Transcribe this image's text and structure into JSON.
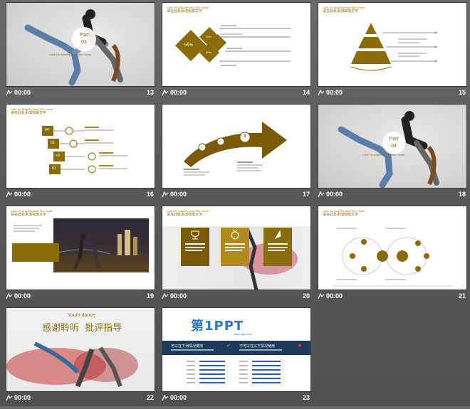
{
  "slides": [
    {
      "number": "13",
      "time": "00:00",
      "part_label": "Part",
      "part_num": "03",
      "subtitle": "Click On Add/Replace/Title Inside"
    },
    {
      "number": "14",
      "time": "00:00",
      "title_en": "Click On Add/Replace/Title Inside",
      "title_cn": "请在此处添加标题文字",
      "center_pct": "55%",
      "pct_a": "20%",
      "pct_b": "35%"
    },
    {
      "number": "15",
      "time": "00:00",
      "title_en": "Click On Add/Replace/Title Inside",
      "title_cn": "请在此处添加标题文字"
    },
    {
      "number": "16",
      "time": "00:00",
      "title_en": "Click On Add/Replace/Title Inside",
      "title_cn": "请在此处添加标题文字",
      "steps": [
        "04",
        "03",
        "02",
        "01"
      ]
    },
    {
      "number": "17",
      "time": "00:00",
      "markers": [
        "1",
        "2",
        "3"
      ]
    },
    {
      "number": "18",
      "time": "00:00",
      "part_label": "Part",
      "part_num": "04",
      "subtitle": "Click On Add/Replace/Title Inside"
    },
    {
      "number": "19",
      "time": "00:00",
      "title_en": "Click On Add/Replace/Title Inside",
      "title_cn": "请在此处添加标题文字"
    },
    {
      "number": "20",
      "time": "00:00",
      "title_en": "Click On Add/Replace/Title Inside",
      "title_cn": "请在此处添加标题文字"
    },
    {
      "number": "21",
      "time": "00:00",
      "title_en": "Click On Add/Replace/Title Inside",
      "title_cn": "请在此处添加标题文字"
    },
    {
      "number": "22",
      "time": "00:00",
      "youth": "Youth dance",
      "thanks": "感谢聆听  批评指导"
    },
    {
      "number": "23",
      "time": "00:00",
      "logo_text": "第1PPT",
      "logo_url": "www.1ppt.com",
      "left_head": "可以在下列情况使用",
      "right_head": "不可以在以下情况使用"
    }
  ]
}
